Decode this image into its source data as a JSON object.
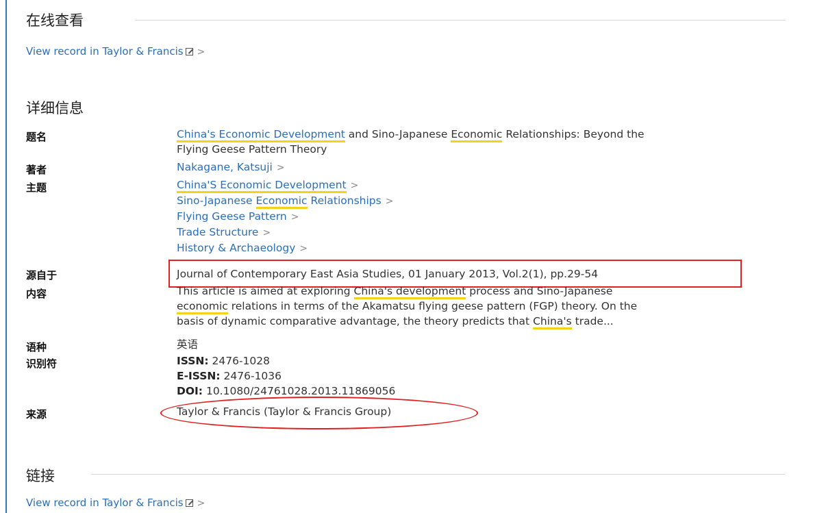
{
  "sections": {
    "online": "在线查看",
    "details": "详细信息",
    "links": "链接"
  },
  "view_record_link": "View record in Taylor & Francis",
  "fields": {
    "title_label": "题名",
    "title_parts": [
      "China's Economic Development",
      " and Sino-Japanese ",
      "Economic",
      " Relationships: Beyond the",
      "Flying Geese Pattern Theory"
    ],
    "author_label": "著者",
    "author": "Nakagane, Katsuji",
    "subject_label": "主题",
    "subjects": [
      {
        "hl": "China'S Economic Development",
        "rest": ""
      },
      {
        "pre": "Sino-Japanese ",
        "hl": "Economic",
        "rest": " Relationships"
      },
      {
        "rest": "Flying Geese Pattern"
      },
      {
        "rest": "Trade Structure"
      },
      {
        "rest": "History & Archaeology"
      }
    ],
    "source_label": "源自于",
    "source": "Journal of Contemporary East Asia Studies, 01 January 2013, Vol.2(1), pp.29-54",
    "content_label": "内容",
    "content_parts": [
      "This article is aimed at exploring ",
      "China's development",
      " process and Sino-Japanese",
      "economic",
      " relations in terms of the Akamatsu flying geese pattern (FGP) theory. On the",
      "basis of dynamic comparative advantage, the theory predicts that ",
      "China's",
      " trade..."
    ],
    "language_label": "语种",
    "language": "英语",
    "identifier_label": "识别符",
    "issn_label": "ISSN:",
    "issn": "2476-1028",
    "eissn_label": "E-ISSN:",
    "eissn": "2476-1036",
    "doi_label": "DOI:",
    "doi": "10.1080/24761028.2013.11869056",
    "origin_label": "来源",
    "origin": "Taylor & Francis (Taylor & Francis Group)"
  }
}
